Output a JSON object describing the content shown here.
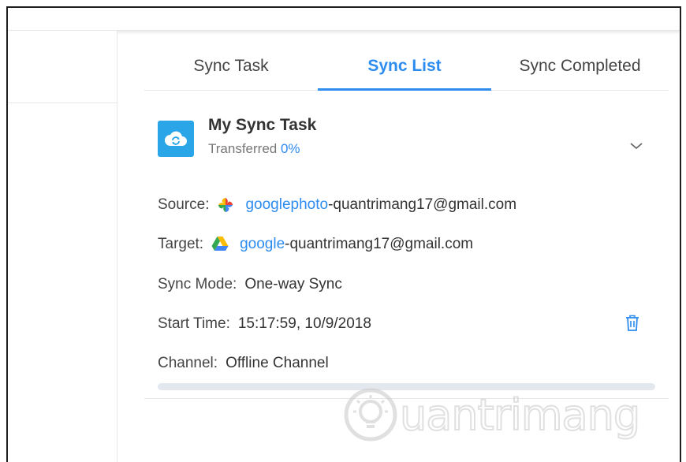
{
  "tabs": [
    {
      "label": "Sync Task",
      "active": false
    },
    {
      "label": "Sync List",
      "active": true
    },
    {
      "label": "Sync Completed",
      "active": false
    }
  ],
  "task": {
    "title": "My Sync Task",
    "transferred_label": "Transferred",
    "transferred_pct": "0%",
    "progress_fraction": 0,
    "icon": "cloud-sync-icon",
    "source": {
      "label": "Source:",
      "icon": "google-photos-icon",
      "service": "googlephoto",
      "account": "-quantrimang17@gmail.com"
    },
    "target": {
      "label": "Target:",
      "icon": "google-drive-icon",
      "service": "google",
      "account": "-quantrimang17@gmail.com"
    },
    "sync_mode": {
      "label": "Sync Mode:",
      "value": "One-way Sync"
    },
    "start_time": {
      "label": "Start Time:",
      "value": "15:17:59, 10/9/2018"
    },
    "channel": {
      "label": "Channel:",
      "value": "Offline Channel"
    }
  },
  "watermark": {
    "text": "uantrimang"
  },
  "colors": {
    "accent": "#2d8cf0",
    "app_icon": "#2aa6e8",
    "progress_track": "#e3e8ef"
  }
}
